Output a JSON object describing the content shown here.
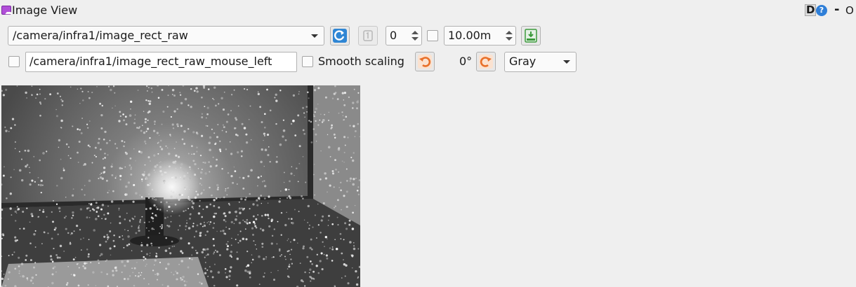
{
  "window": {
    "title": "Image View",
    "d_label": "D",
    "help_label": "?",
    "minimize_label": "-",
    "close_label": "O"
  },
  "toolbar": {
    "topic": "/camera/infra1/image_rect_raw",
    "frame_value": "0",
    "max_range": "10.00m",
    "mouse_topic": "/camera/infra1/image_rect_raw_mouse_left",
    "smooth_scaling_label": "Smooth scaling",
    "smooth_scaling_checked": false,
    "rotation": "0°",
    "color_scheme": "Gray"
  },
  "colors": {
    "accent_refresh": "#2f86d4",
    "accent_rotate": "#e8702a",
    "save_icon": "#3c9a3c"
  },
  "image": {
    "scene": "grayscale infrared camera frame with projected dot pattern"
  }
}
